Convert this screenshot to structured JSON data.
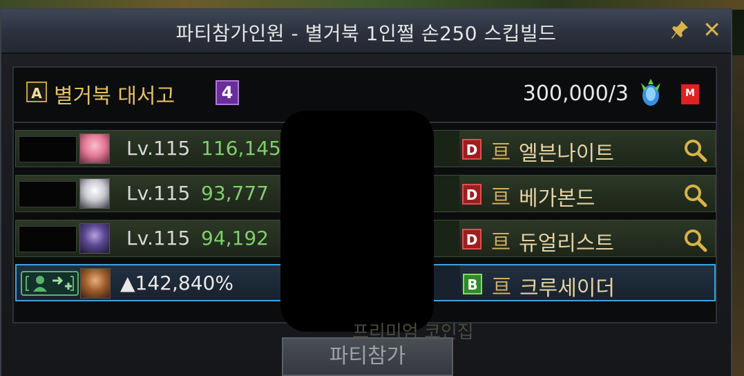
{
  "window": {
    "title": "파티참가인원 - 별거북 1인쩔 손250 스킵빌드",
    "pin_icon": "pin-icon",
    "close_icon": "close-icon"
  },
  "party": {
    "badge": "A",
    "name": "별거북 대서고",
    "count": "4",
    "gold": "300,000/3",
    "gem_icon": "blue-gem-icon",
    "mail_icon": "m-icon",
    "mail_label": "M"
  },
  "members": [
    {
      "level": "Lv.115",
      "power": "116,145",
      "grade": "D",
      "job": "엘븐나이트"
    },
    {
      "level": "Lv.115",
      "power": "93,777",
      "grade": "D",
      "job": "베가본드"
    },
    {
      "level": "Lv.115",
      "power": "94,192",
      "grade": "D",
      "job": "듀얼리스트"
    }
  ],
  "me": {
    "rate": "▲142,840%",
    "grade": "B",
    "job": "크루세이더"
  },
  "rank_glyph": "亘",
  "behind_text": "프리미엄 코인집",
  "join_button": "파티참가",
  "colors": {
    "gold_text": "#e2c064",
    "power_green": "#7fcf6a",
    "highlight_blue": "#3aa6e0",
    "grade_d": "#9c1e1e",
    "grade_b": "#2f8a2a"
  }
}
